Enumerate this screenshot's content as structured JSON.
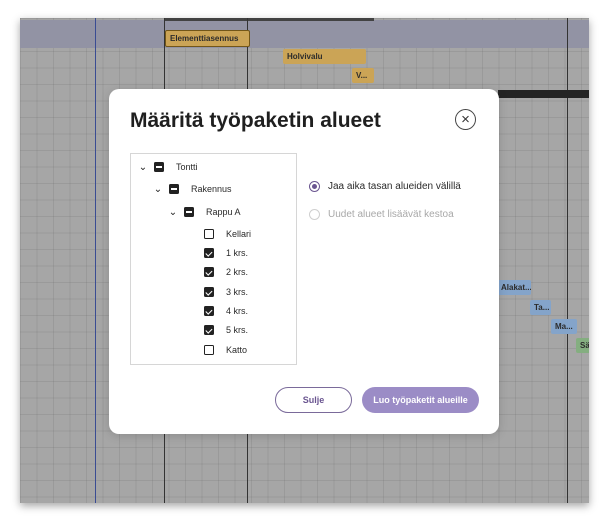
{
  "background": {
    "tasks": [
      {
        "label": "Elementtiasennus"
      },
      {
        "label": "Holvivalu"
      },
      {
        "label": "V..."
      },
      {
        "label": "Alakat..."
      },
      {
        "label": "Ta..."
      },
      {
        "label": "Ma..."
      },
      {
        "label": "Sä"
      }
    ]
  },
  "dialog": {
    "title": "Määritä työpaketin alueet",
    "close_icon": "×",
    "tree": [
      {
        "label": "Tontti",
        "state": "partial",
        "expanded": true
      },
      {
        "label": "Rakennus",
        "state": "partial",
        "expanded": true
      },
      {
        "label": "Rappu A",
        "state": "partial",
        "expanded": true
      },
      {
        "label": "Kellari",
        "state": "unchecked"
      },
      {
        "label": "1 krs.",
        "state": "checked"
      },
      {
        "label": "2 krs.",
        "state": "checked"
      },
      {
        "label": "3 krs.",
        "state": "checked"
      },
      {
        "label": "4 krs.",
        "state": "checked"
      },
      {
        "label": "5 krs.",
        "state": "checked"
      },
      {
        "label": "Katto",
        "state": "unchecked"
      }
    ],
    "options": [
      {
        "label": "Jaa aika tasan alueiden välillä",
        "selected": true
      },
      {
        "label": "Uudet alueet lisäävät kestoa",
        "selected": false
      }
    ],
    "buttons": {
      "close": "Sulje",
      "create": "Luo työpaketit alueille"
    }
  },
  "colors": {
    "accent": "#6a5590",
    "primary_button": "#9b8cc6",
    "task_orange": "#e0b35a",
    "task_blue": "#8fb3de",
    "task_green": "#8fbf8a"
  }
}
